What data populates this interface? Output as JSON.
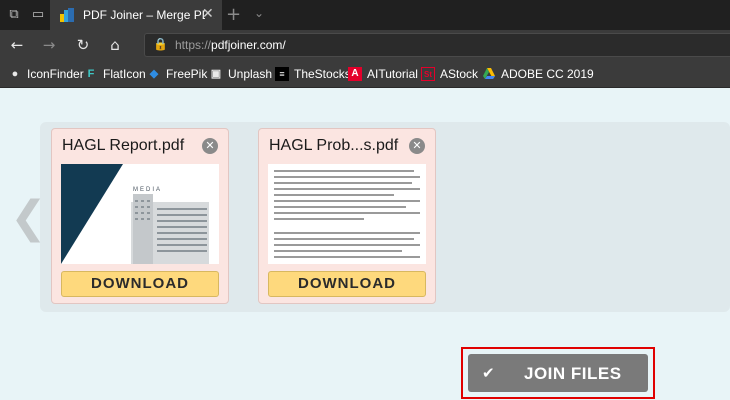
{
  "browser": {
    "tab": {
      "title": "PDF Joiner – Merge PDF",
      "favicon": "pdfjoiner-favicon"
    },
    "icons": {
      "tab_actions": "tab-actions-icon",
      "tab_preview": "tab-preview-icon",
      "close": "close-icon",
      "new_tab": "plus-icon",
      "tab_menu": "chevron-down-icon"
    },
    "nav": {
      "back": "arrow-left-icon",
      "forward": "arrow-right-icon",
      "refresh": "refresh-icon",
      "home": "home-icon"
    },
    "url": {
      "prefix": "https://",
      "host": "pdfjoiner.com/"
    },
    "bookmarks": [
      {
        "label": "IconFinder",
        "icon": "iconfinder-icon"
      },
      {
        "label": "FlatIcon",
        "icon": "flaticon-icon"
      },
      {
        "label": "FreePik",
        "icon": "freepik-icon"
      },
      {
        "label": "Unplash",
        "icon": "camera-icon"
      },
      {
        "label": "TheStocks",
        "icon": "thestocks-icon"
      },
      {
        "label": "AITutorial",
        "icon": "adobe-icon"
      },
      {
        "label": "AStock",
        "icon": "adobe-stock-icon"
      },
      {
        "label": "ADOBE CC 2019",
        "icon": "drive-icon"
      }
    ]
  },
  "files": [
    {
      "name": "HAGL Report.pdf",
      "download_label": "DOWNLOAD",
      "thumb": "building-cover-thumbnail"
    },
    {
      "name": "HAGL Prob...s.pdf",
      "download_label": "DOWNLOAD",
      "thumb": "text-page-thumbnail",
      "thumb_logo": "MEDIA"
    }
  ],
  "join": {
    "label": "JOIN FILES",
    "icon": "check-icon"
  },
  "colors": {
    "card_bg": "#fbe5e1",
    "download_bg": "#fed97d",
    "join_bg": "#7a7a7a",
    "highlight": "#e00000",
    "page_bg": "#e8f4f7"
  }
}
